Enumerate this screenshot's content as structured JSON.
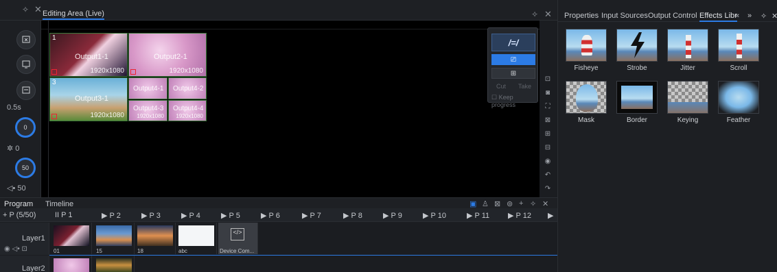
{
  "editing": {
    "title": "Editing Area (Live)",
    "outputs": [
      {
        "num": "1",
        "label": "Output1-1",
        "res": "1920x1080"
      },
      {
        "num": "2",
        "label": "Output2-1",
        "res": "1920x1080"
      },
      {
        "num": "3",
        "label": "Output3-1",
        "res": "1920x1080"
      },
      {
        "num": "",
        "label": "Output4-1",
        "res": ""
      },
      {
        "num": "",
        "label": "Output4-2",
        "res": ""
      },
      {
        "num": "",
        "label": "Output4-3",
        "res": "1920x1080"
      },
      {
        "num": "",
        "label": "Output4-4",
        "res": "1920x1080"
      }
    ]
  },
  "left_tools": {
    "duration": "0.5s",
    "knob1": "0",
    "brightness": "0",
    "knob2": "50",
    "volume": "50"
  },
  "control_panel": {
    "logo": "/=/",
    "cut": "Cut",
    "take": "Take",
    "keep_progress": "Keep progress"
  },
  "right_panel": {
    "tabs": [
      "Properties",
      "Input Sources",
      "Output Control",
      "Effects Libr",
      "«",
      "»"
    ],
    "effects": [
      "Fisheye",
      "Strobe",
      "Jitter",
      "Scroll",
      "Mask",
      "Border",
      "Keying",
      "Feather"
    ]
  },
  "program": {
    "tabs": [
      "Program",
      "Timeline"
    ],
    "page_count": "+ P (5/50)",
    "pages": [
      "II  P 1",
      "▶  P 2",
      "▶  P 3",
      "▶  P 4",
      "▶  P 5",
      "▶  P 6",
      "▶  P 7",
      "▶  P 8",
      "▶  P 9",
      "▶  P 10",
      "▶  P 11",
      "▶  P 12",
      "▶"
    ],
    "layers": [
      {
        "name": "Layer1",
        "items": [
          "01",
          "15",
          "18",
          "abc",
          "Device Com..."
        ]
      },
      {
        "name": "Layer2",
        "items": [
          "",
          ""
        ]
      }
    ]
  },
  "colors": {
    "accent": "#2c7be5",
    "background": "#1b1d21"
  }
}
